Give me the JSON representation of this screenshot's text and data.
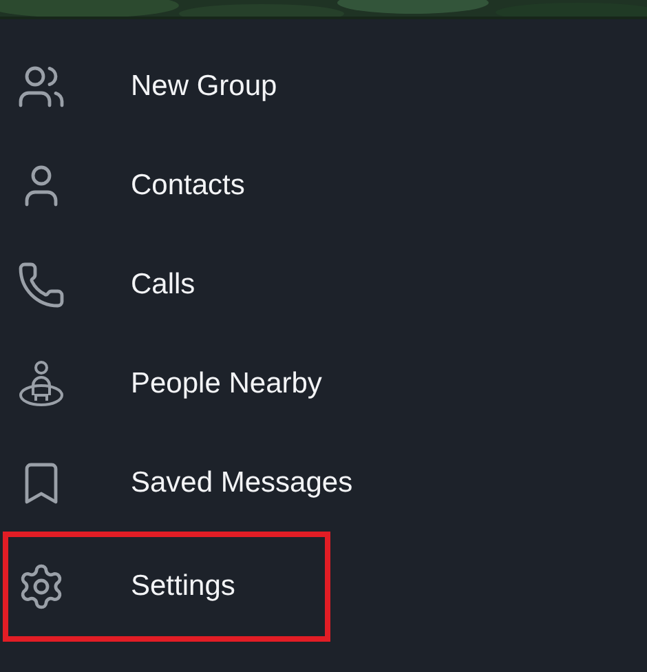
{
  "menu": [
    {
      "label": "New Group",
      "kind": "group",
      "highlighted": false
    },
    {
      "label": "Contacts",
      "kind": "contact",
      "highlighted": false
    },
    {
      "label": "Calls",
      "kind": "phone",
      "highlighted": false
    },
    {
      "label": "People Nearby",
      "kind": "nearby",
      "highlighted": false
    },
    {
      "label": "Saved Messages",
      "kind": "bookmark",
      "highlighted": false
    },
    {
      "label": "Settings",
      "kind": "settings",
      "highlighted": true
    }
  ]
}
